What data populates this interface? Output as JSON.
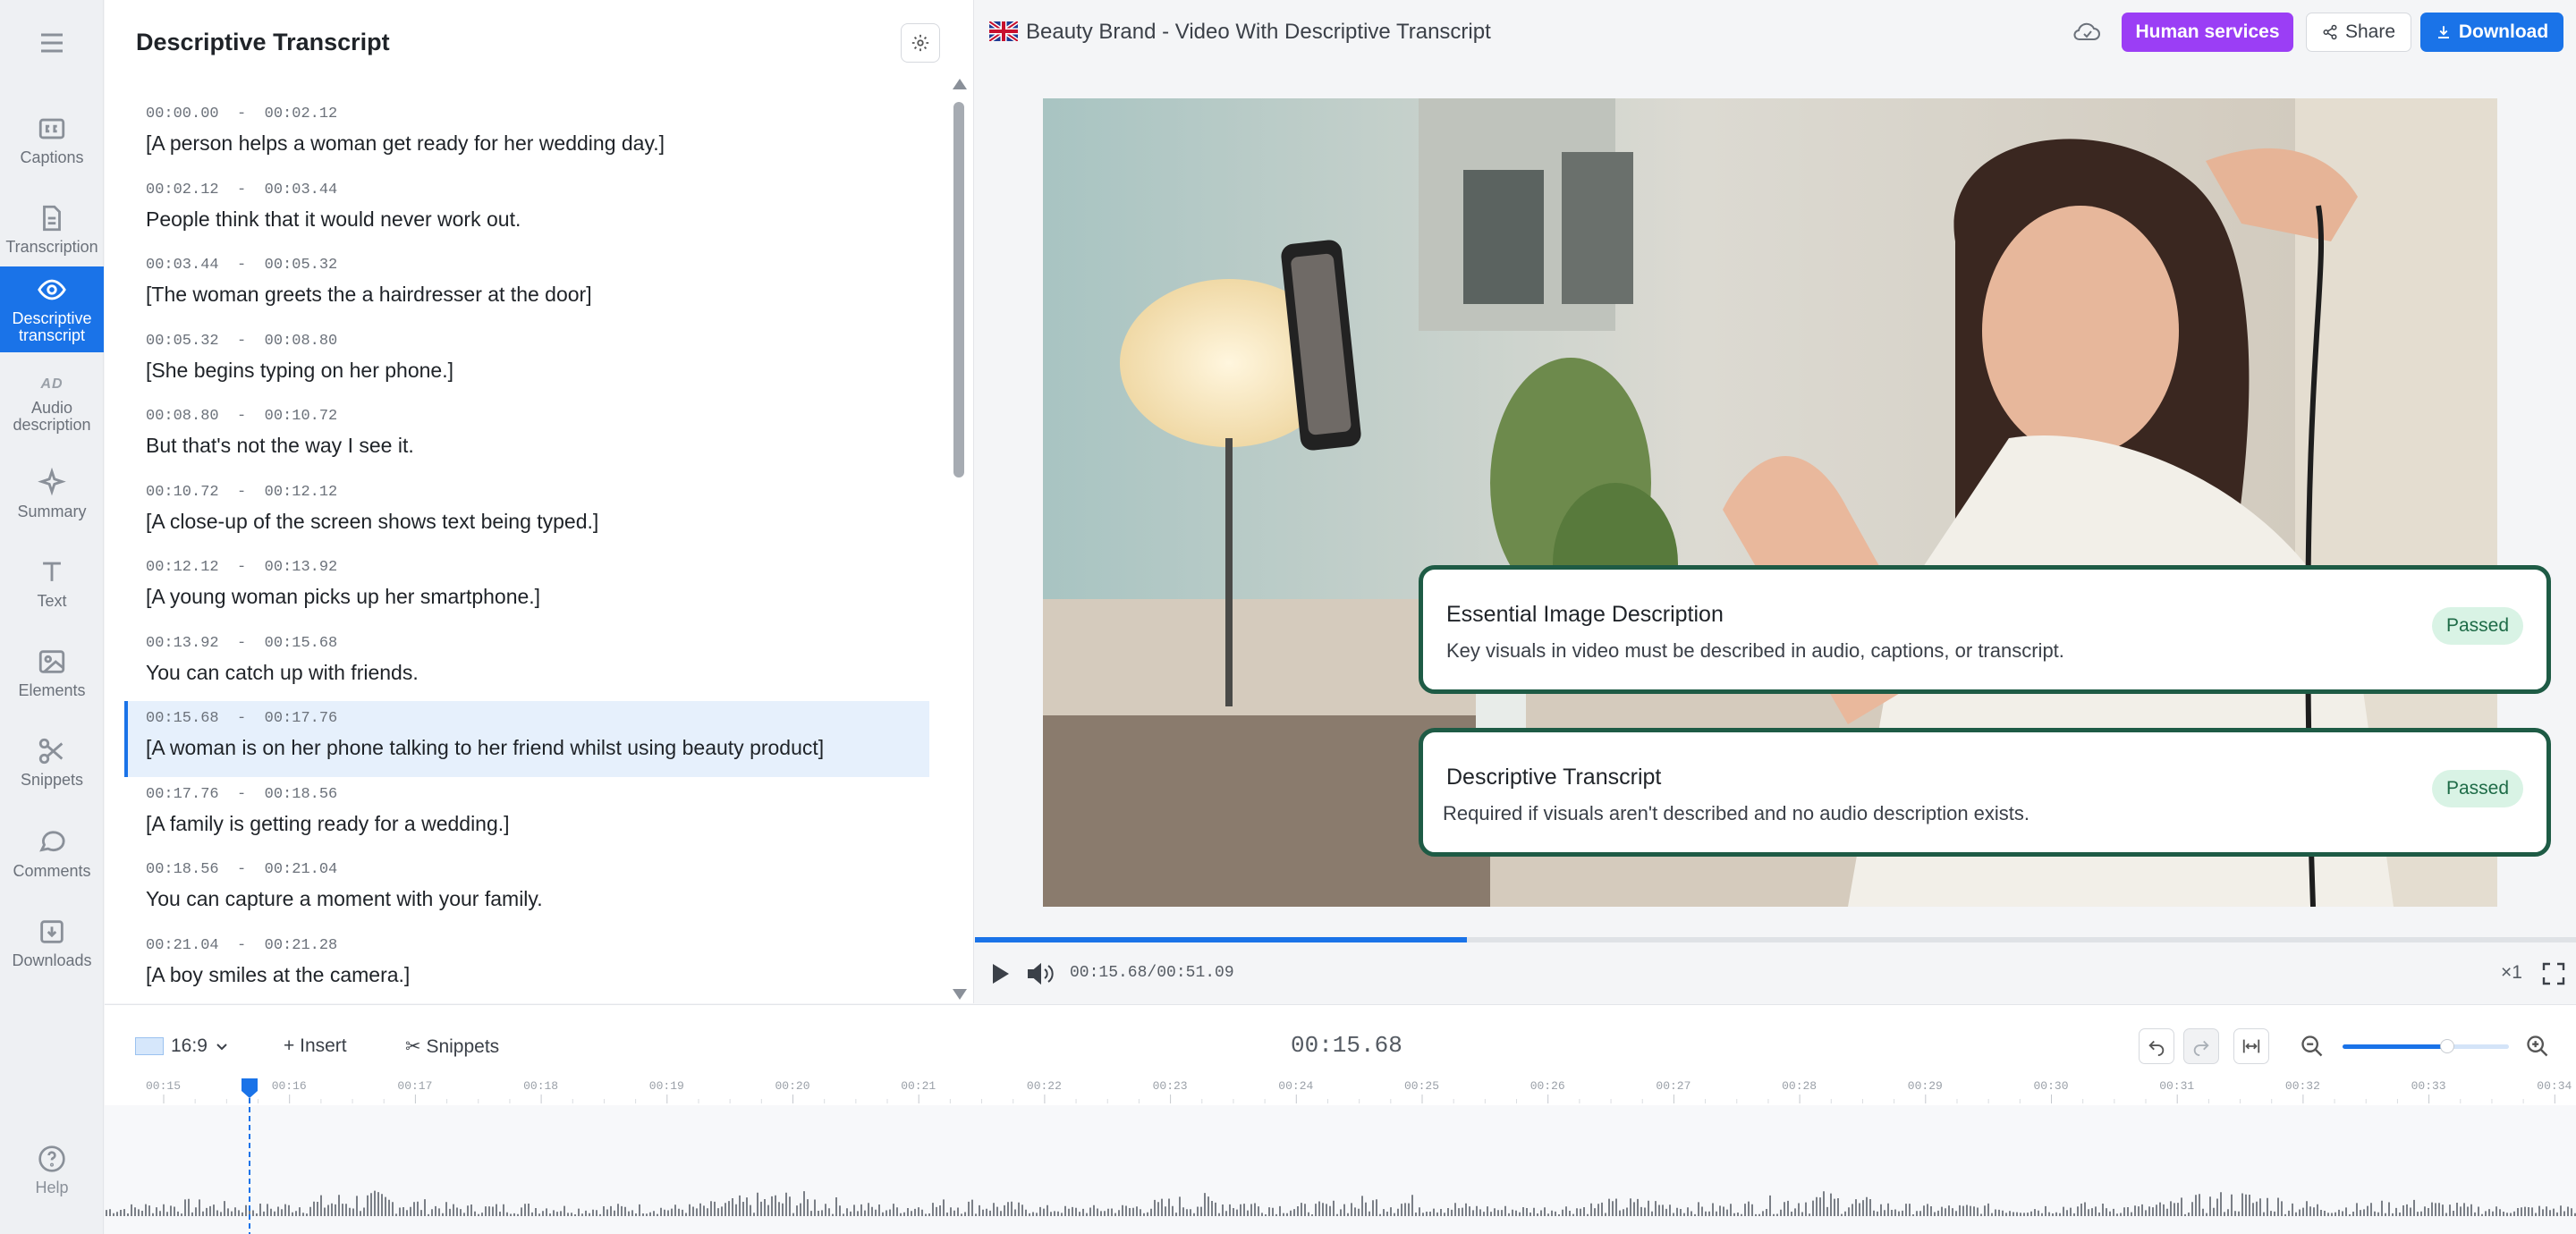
{
  "rail": {
    "items": [
      {
        "label": "Captions"
      },
      {
        "label": "Transcription"
      },
      {
        "label": "Descriptive transcript"
      },
      {
        "label": "Audio description"
      },
      {
        "label": "Summary"
      },
      {
        "label": "Text"
      },
      {
        "label": "Elements"
      },
      {
        "label": "Snippets"
      },
      {
        "label": "Comments"
      },
      {
        "label": "Downloads"
      }
    ],
    "help_label": "Help",
    "ad_glyph": "AD"
  },
  "panel": {
    "title": "Descriptive Transcript",
    "segments": [
      {
        "start": "00:00.00",
        "end": "00:02.12",
        "text": "[A person helps a woman get ready for her wedding day.]"
      },
      {
        "start": "00:02.12",
        "end": "00:03.44",
        "text": "People think that it would never work out."
      },
      {
        "start": "00:03.44",
        "end": "00:05.32",
        "text": "[The woman greets the a hairdresser at the door]"
      },
      {
        "start": "00:05.32",
        "end": "00:08.80",
        "text": "[She begins typing on her phone.]"
      },
      {
        "start": "00:08.80",
        "end": "00:10.72",
        "text": "But that's not the way I see it."
      },
      {
        "start": "00:10.72",
        "end": "00:12.12",
        "text": "[A close-up of the screen shows text being typed.]"
      },
      {
        "start": "00:12.12",
        "end": "00:13.92",
        "text": "[A young woman picks up her smartphone.]"
      },
      {
        "start": "00:13.92",
        "end": "00:15.68",
        "text": "You can catch up with friends."
      },
      {
        "start": "00:15.68",
        "end": "00:17.76",
        "text": "[A woman is on her phone talking to her friend whilst using beauty product]"
      },
      {
        "start": "00:17.76",
        "end": "00:18.56",
        "text": "[A family is getting ready for a wedding.]"
      },
      {
        "start": "00:18.56",
        "end": "00:21.04",
        "text": "You can capture a moment with your family."
      },
      {
        "start": "00:21.04",
        "end": "00:21.28",
        "text": "[A boy smiles at the camera.]"
      }
    ],
    "active_index": 8
  },
  "header": {
    "title": "Beauty Brand - Video With Descriptive Transcript",
    "human_services": "Human services",
    "share": "Share",
    "download": "Download"
  },
  "checks": [
    {
      "title": "Essential Image Description",
      "desc": "Key visuals in video must be described in audio, captions, or transcript.",
      "status": "Passed"
    },
    {
      "title": "Descriptive Transcript",
      "desc": "Required if visuals aren't described and no audio description exists.",
      "status": "Passed"
    }
  ],
  "player": {
    "current": "00:15.68",
    "separator": "/",
    "duration": "00:51.09",
    "progress": 0.307,
    "speed": "×1"
  },
  "timeline": {
    "aspect": "16:9",
    "insert": "Insert",
    "snippets": "Snippets",
    "current": "00:15.68",
    "zoom_level": 0.63,
    "ticks": [
      "00:15",
      "00:16",
      "00:17",
      "00:18",
      "00:19",
      "00:20",
      "00:21",
      "00:22",
      "00:23",
      "00:24",
      "00:25",
      "00:26",
      "00:27",
      "00:28",
      "00:29",
      "00:30",
      "00:31",
      "00:32",
      "00:33",
      "00:34"
    ]
  },
  "colors": {
    "accent": "#1a73e8",
    "human_services": "#9b3ef5",
    "check_border": "#1e5b45",
    "badge_bg": "#d9f3e5"
  }
}
